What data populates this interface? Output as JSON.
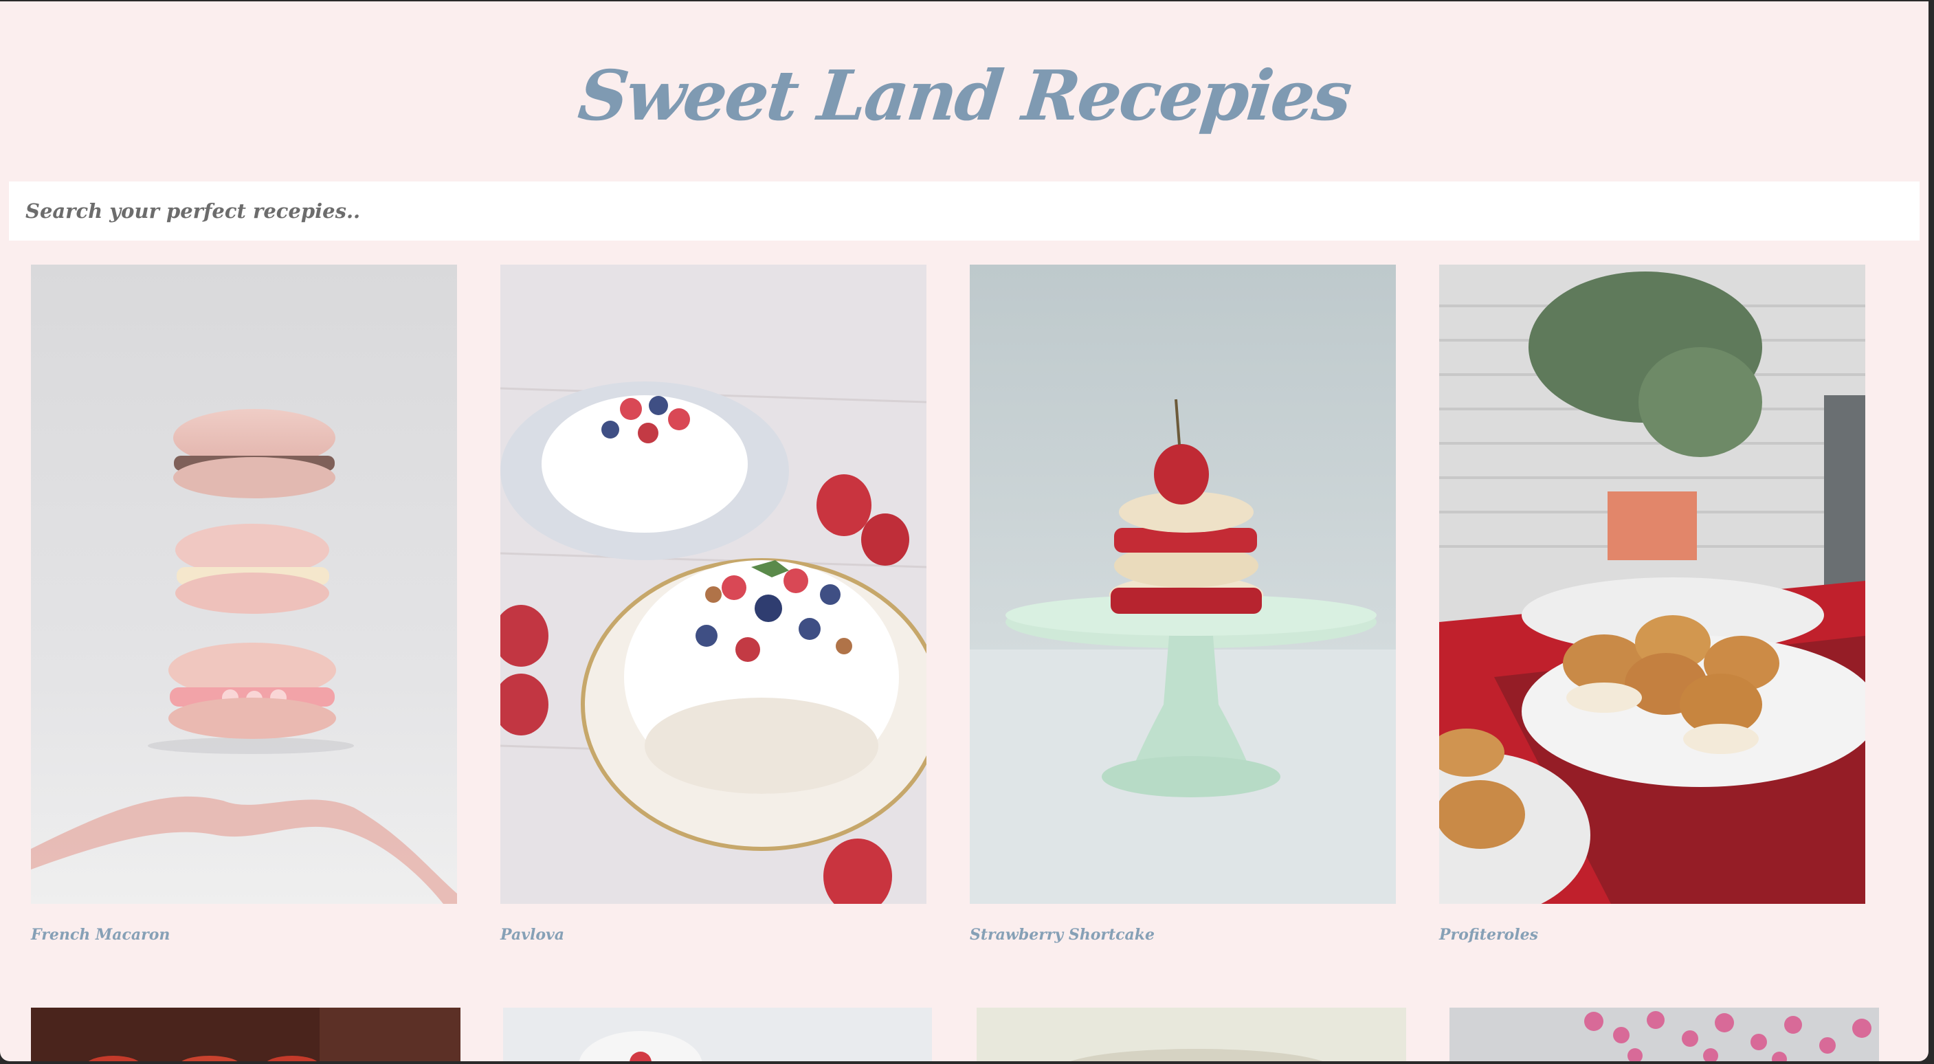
{
  "header": {
    "title": "Sweet Land Recepies"
  },
  "search": {
    "placeholder": "Search your perfect recepies.."
  },
  "recipes": [
    {
      "name": "French Macaron"
    },
    {
      "name": "Pavlova"
    },
    {
      "name": "Strawberry Shortcake"
    },
    {
      "name": "Profiteroles"
    }
  ],
  "colors": {
    "background": "#fbeeee",
    "title": "#7f9ab2",
    "label": "#86a0b6",
    "search_bg": "#ffffff",
    "search_text": "#6c6c6c"
  }
}
